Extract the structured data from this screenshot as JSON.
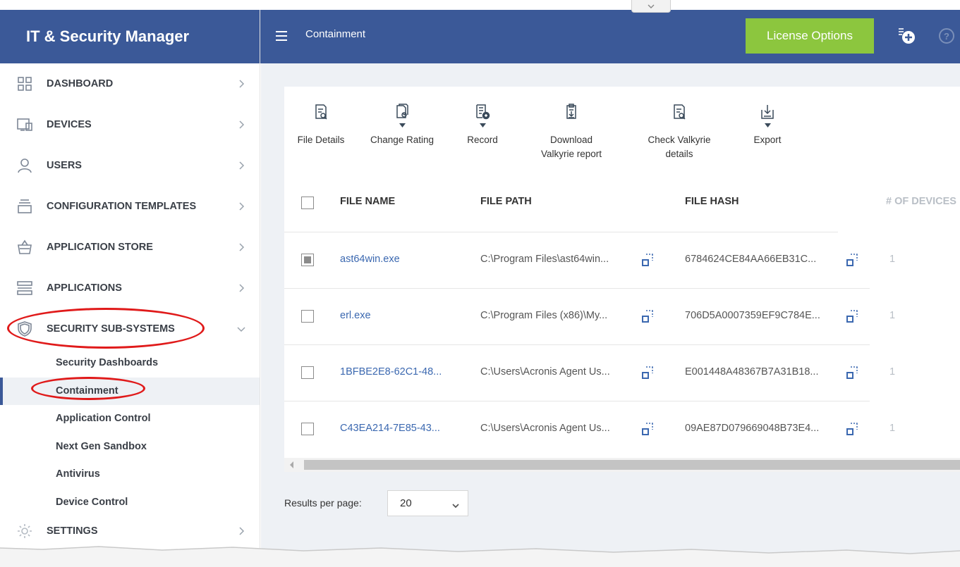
{
  "app": {
    "title": "IT & Security Manager"
  },
  "topbar": {
    "page_title": "Containment",
    "license_button": "License Options",
    "colors": {
      "bar": "#3b5998",
      "license": "#8cc63e"
    }
  },
  "sidebar": {
    "items": [
      {
        "label": "DASHBOARD",
        "icon": "grid-icon"
      },
      {
        "label": "DEVICES",
        "icon": "devices-icon"
      },
      {
        "label": "USERS",
        "icon": "user-icon"
      },
      {
        "label": "CONFIGURATION TEMPLATES",
        "icon": "templates-icon"
      },
      {
        "label": "APPLICATION STORE",
        "icon": "store-basket-icon"
      },
      {
        "label": "APPLICATIONS",
        "icon": "applications-icon"
      },
      {
        "label": "SECURITY SUB-SYSTEMS",
        "icon": "shield-icon"
      }
    ],
    "sub_items": [
      {
        "label": "Security Dashboards"
      },
      {
        "label": "Containment",
        "active": true
      },
      {
        "label": "Application Control"
      },
      {
        "label": "Next Gen Sandbox"
      },
      {
        "label": "Antivirus"
      },
      {
        "label": "Device Control"
      }
    ],
    "settings": {
      "label": "SETTINGS",
      "icon": "gear-icon"
    }
  },
  "toolbar": {
    "file_details": "File Details",
    "change_rating": "Change Rating",
    "record": "Record",
    "download_valkyrie_1": "Download",
    "download_valkyrie_2": "Valkyrie report",
    "check_valkyrie_1": "Check Valkyrie",
    "check_valkyrie_2": "details",
    "export": "Export"
  },
  "table": {
    "columns": [
      "FILE NAME",
      "FILE PATH",
      "FILE HASH",
      "# OF DEVICES"
    ],
    "rows": [
      {
        "checked": true,
        "file_name": "ast64win.exe",
        "file_path": "C:\\Program Files\\ast64win...",
        "file_hash": "6784624CE84AA66EB31C...",
        "devices": "1"
      },
      {
        "checked": false,
        "file_name": "erl.exe",
        "file_path": "C:\\Program Files (x86)\\My...",
        "file_hash": "706D5A0007359EF9C784E...",
        "devices": "1"
      },
      {
        "checked": false,
        "file_name": "1BFBE2E8-62C1-48...",
        "file_path": "C:\\Users\\Acronis Agent Us...",
        "file_hash": "E001448A48367B7A31B18...",
        "devices": "1"
      },
      {
        "checked": false,
        "file_name": "C43EA214-7E85-43...",
        "file_path": "C:\\Users\\Acronis Agent Us...",
        "file_hash": "09AE87D079669048B73E4...",
        "devices": "1"
      }
    ]
  },
  "pagination": {
    "label": "Results per page:",
    "value": "20"
  }
}
